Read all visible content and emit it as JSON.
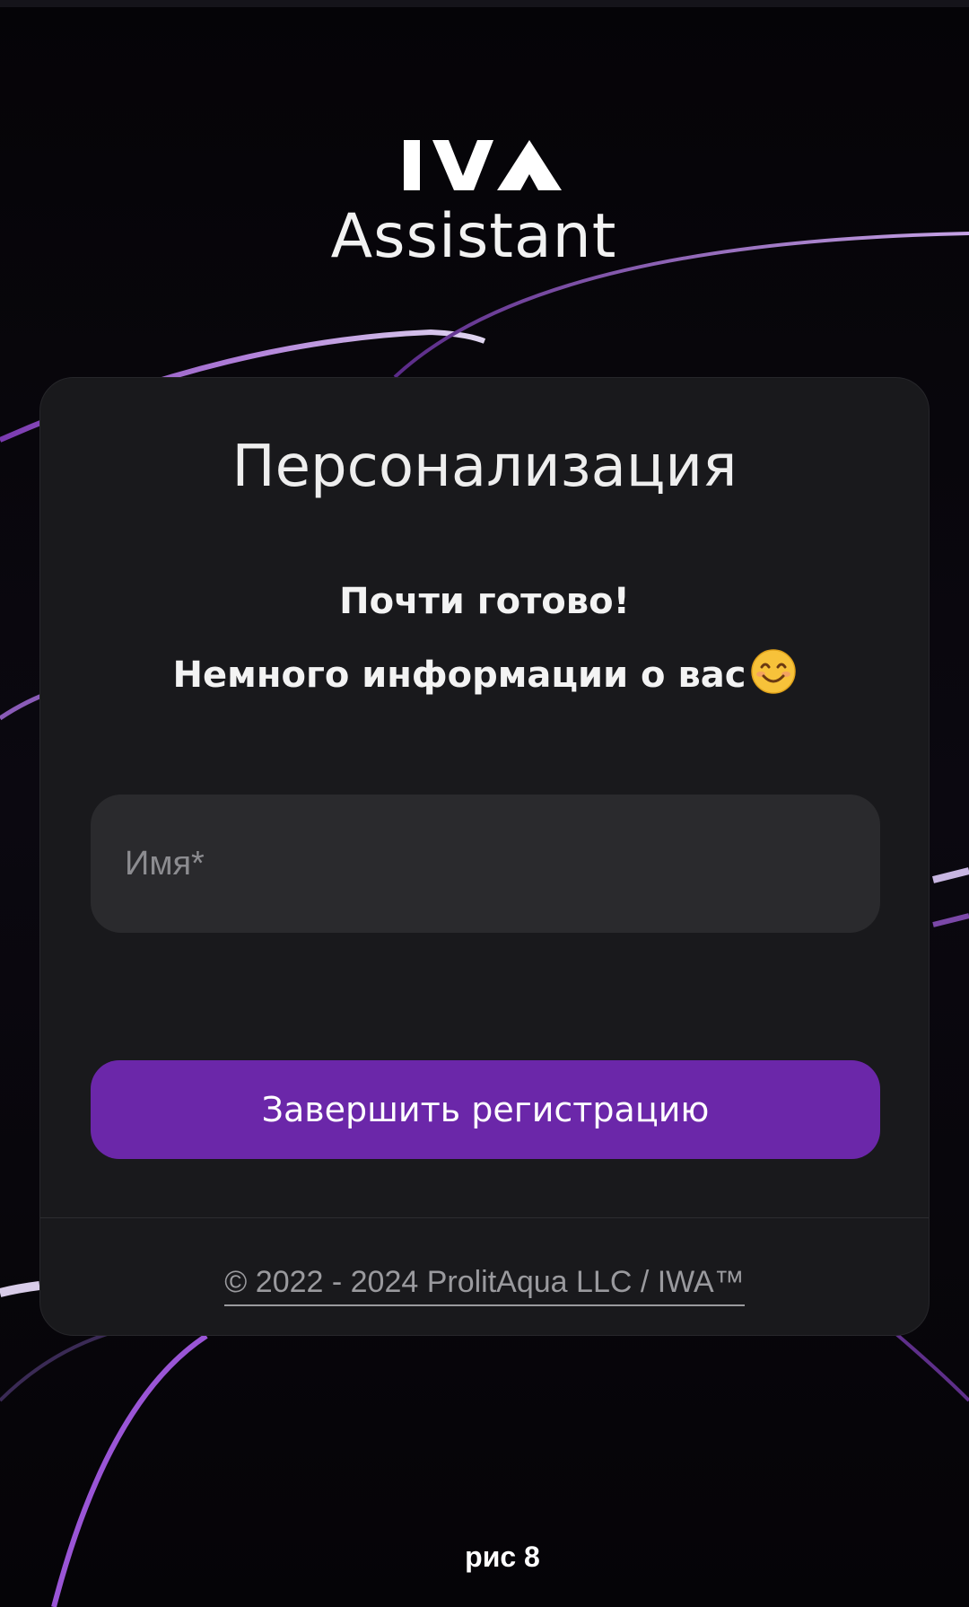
{
  "brand": {
    "logo_text": "IWA",
    "subtitle": "Assistant"
  },
  "card": {
    "title": "Персонализация",
    "subtitle_line1": "Почти готово!",
    "subtitle_line2": "Немного информации о вас",
    "emoji_icon": "smiling-face-icon"
  },
  "form": {
    "name_value": "",
    "name_placeholder": "Имя*",
    "submit_label": "Завершить регистрацию"
  },
  "footer": {
    "copyright": "© 2022 - 2024 ProlitAqua LLC / IWA™"
  },
  "caption": "рис 8",
  "colors": {
    "accent": "#6b27a9",
    "card_bg": "#19191c",
    "field_bg": "#2a2a2d",
    "page_bg": "#050407"
  }
}
